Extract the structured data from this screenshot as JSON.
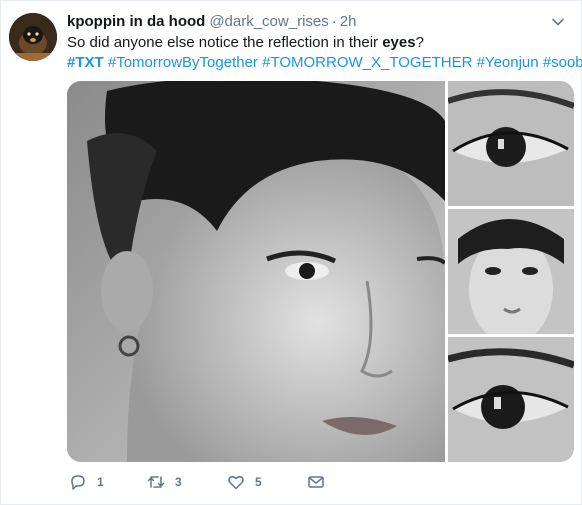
{
  "tweet": {
    "author_name": "kpoppin in da hood",
    "author_handle": "@dark_cow_rises",
    "separator": "·",
    "time": "2h",
    "text_before": "So did anyone else notice the reflection in their ",
    "text_bold": "eyes",
    "text_after": "?",
    "hashtags": [
      "#TXT",
      "#TomorrowByTogether",
      "#TOMORROW_X_TOGETHER",
      "#Yeonjun",
      "#soobin"
    ]
  },
  "media": {
    "images": [
      {
        "name": "portrait-main",
        "icon": "face-portrait"
      },
      {
        "name": "eye-closeup-1",
        "icon": "eye-closeup"
      },
      {
        "name": "portrait-small",
        "icon": "face-portrait"
      },
      {
        "name": "eye-closeup-2",
        "icon": "eye-closeup"
      }
    ]
  },
  "actions": {
    "reply_count": "1",
    "retweet_count": "3",
    "like_count": "5"
  },
  "colors": {
    "link": "#1b95e0",
    "muted": "#657786",
    "text": "#14171a",
    "border": "#e6ecf0"
  }
}
